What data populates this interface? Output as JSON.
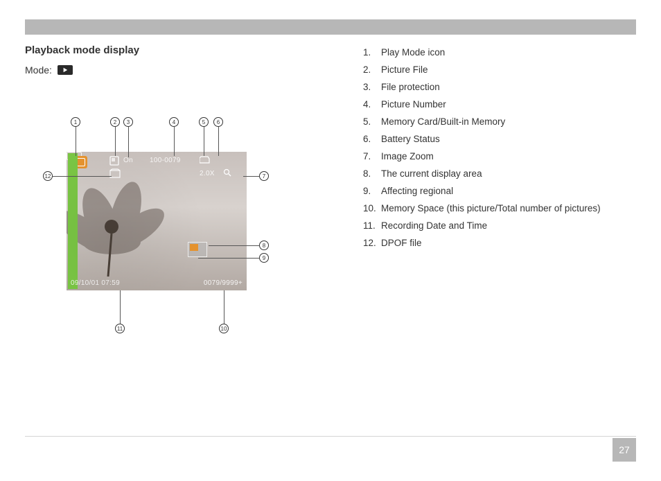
{
  "page_number": "27",
  "title": "Playback mode display",
  "mode_label": "Mode:",
  "screen_osd": {
    "protect_text": "On",
    "picture_number": "100-0079",
    "zoom_text": "2.0X",
    "recording_datetime": "09/10/01 07:59",
    "memory_space": "0079/9999+"
  },
  "callouts": [
    "1",
    "2",
    "3",
    "4",
    "5",
    "6",
    "7",
    "8",
    "9",
    "10",
    "11",
    "12"
  ],
  "legend": [
    {
      "num": "1.",
      "text": "Play Mode icon"
    },
    {
      "num": "2.",
      "text": "Picture File"
    },
    {
      "num": "3.",
      "text": "File protection"
    },
    {
      "num": "4.",
      "text": "Picture Number"
    },
    {
      "num": "5.",
      "text": "Memory Card/Built-in Memory"
    },
    {
      "num": "6.",
      "text": "Battery Status"
    },
    {
      "num": "7.",
      "text": " Image Zoom"
    },
    {
      "num": "8.",
      "text": "The current display area"
    },
    {
      "num": "9.",
      "text": "Affecting regional"
    },
    {
      "num": "10.",
      "text": "Memory Space (this picture/Total number of pictures)"
    },
    {
      "num": "11.",
      "text": "Recording Date and Time"
    },
    {
      "num": "12.",
      "text": "DPOF file"
    }
  ]
}
